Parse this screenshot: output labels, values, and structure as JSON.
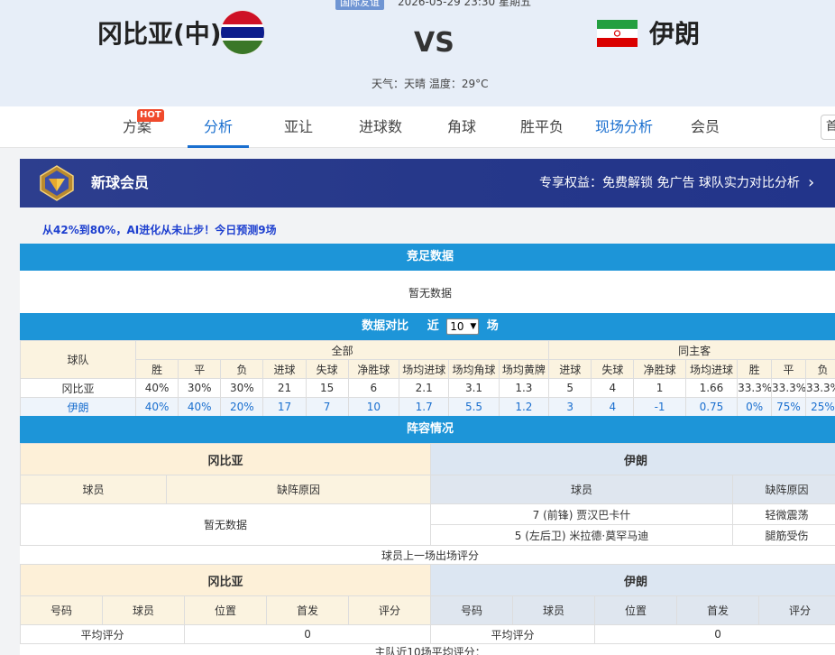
{
  "match": {
    "league": "国际友谊",
    "datetime": "2026-05-29 23:30 星期五",
    "home": "冈比亚(中)",
    "away": "伊朗",
    "vs": "VS",
    "weather": "天气：天晴 温度：29°C"
  },
  "nav": {
    "items": [
      "方案",
      "分析",
      "亚让",
      "进球数",
      "角球",
      "胜平负",
      "现场分析",
      "会员"
    ],
    "active": "分析",
    "hot_badge": "HOT",
    "right_box": "首"
  },
  "member": {
    "title": "新球会员",
    "benefit": "专享权益：免费解锁 免广告 球队实力对比分析",
    "arrow": "›"
  },
  "promo": "从42%到80%，AI进化从未止步！今日预测9场",
  "jingzu": {
    "title": "竞足数据",
    "empty": "暂无数据"
  },
  "compare": {
    "title": "数据对比",
    "near_prefix": "近",
    "near_value": "10",
    "near_suffix": "场",
    "team_col": "球队",
    "group_all": "全部",
    "group_homeaway": "同主客",
    "cols_all": [
      "胜",
      "平",
      "负",
      "进球",
      "失球",
      "净胜球",
      "场均进球",
      "场均角球",
      "场均黄牌"
    ],
    "cols_ha": [
      "进球",
      "失球",
      "净胜球",
      "场均进球",
      "胜",
      "平",
      "负"
    ],
    "rows": [
      {
        "team": "冈比亚",
        "all": [
          "40%",
          "30%",
          "30%",
          "21",
          "15",
          "6",
          "2.1",
          "3.1",
          "1.3"
        ],
        "ha": [
          "5",
          "4",
          "1",
          "1.66",
          "33.3%",
          "33.3%",
          "33.3%"
        ]
      },
      {
        "team": "伊朗",
        "all": [
          "40%",
          "40%",
          "20%",
          "17",
          "7",
          "10",
          "1.7",
          "5.5",
          "1.2"
        ],
        "ha": [
          "3",
          "4",
          "-1",
          "0.75",
          "0%",
          "75%",
          "25%"
        ]
      }
    ]
  },
  "lineup": {
    "title": "阵容情况",
    "home_team": "冈比亚",
    "away_team": "伊朗",
    "col_player": "球员",
    "col_reason": "缺阵原因",
    "home_empty": "暂无数据",
    "away_rows": [
      {
        "player": "7 (前锋) 贾汉巴卡什",
        "reason": "轻微震荡"
      },
      {
        "player": "5 (左后卫) 米拉德·莫罕马迪",
        "reason": "腿筋受伤"
      }
    ]
  },
  "ratings": {
    "title": "球员上一场出场评分",
    "home_team": "冈比亚",
    "away_team": "伊朗",
    "cols": [
      "号码",
      "球员",
      "位置",
      "首发",
      "评分"
    ],
    "avg_label": "平均评分",
    "home_avg": "0",
    "away_avg": "0"
  },
  "footer_label": "主队近10场平均评分："
}
